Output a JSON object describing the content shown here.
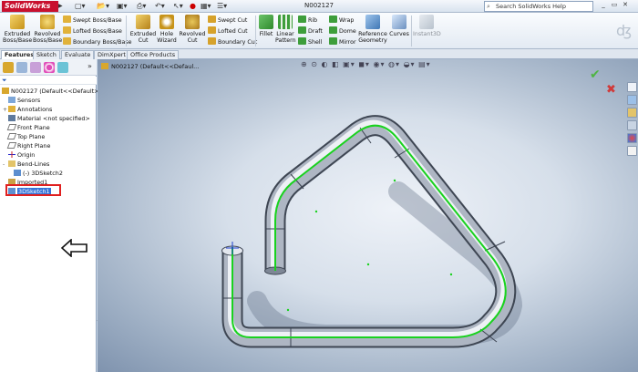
{
  "titlebar": {
    "app_name": "SolidWorks",
    "document_title": "N002127",
    "help_search_placeholder": "Search SolidWorks Help"
  },
  "command_manager": {
    "extruded_boss": "Extruded\nBoss/Base",
    "revolved_boss": "Revolved\nBoss/Base",
    "swept_boss": "Swept Boss/Base",
    "lofted_boss": "Lofted Boss/Base",
    "boundary_boss": "Boundary Boss/Base",
    "extruded_cut": "Extruded\nCut",
    "hole_wizard": "Hole\nWizard",
    "revolved_cut": "Revolved\nCut",
    "swept_cut": "Swept Cut",
    "lofted_cut": "Lofted Cut",
    "boundary_cut": "Boundary Cut",
    "fillet": "Fillet",
    "linear_pattern": "Linear\nPattern",
    "rib": "Rib",
    "draft": "Draft",
    "shell": "Shell",
    "wrap": "Wrap",
    "dome": "Dome",
    "mirror": "Mirror",
    "reference_geometry": "Reference\nGeometry",
    "curves": "Curves",
    "instant3d": "Instant3D"
  },
  "tabs": [
    "Features",
    "Sketch",
    "Evaluate",
    "DimXpert",
    "Office Products"
  ],
  "feature_tree": {
    "root": "N002127  (Default<<Default>_Di",
    "items": [
      "Sensors",
      "Annotations",
      "Material <not specified>",
      "Front Plane",
      "Top Plane",
      "Right Plane",
      "Origin",
      "Bend-Lines",
      "(-) 3DSketch2",
      "Imported1",
      "3DSketch1"
    ]
  },
  "viewport": {
    "title": "N002127  (Default<<Defaul..."
  },
  "colors": {
    "selection": "#3473d8",
    "highlight_box": "#e02020",
    "sketch_line": "#19d21e",
    "brand": "#c8102e"
  }
}
